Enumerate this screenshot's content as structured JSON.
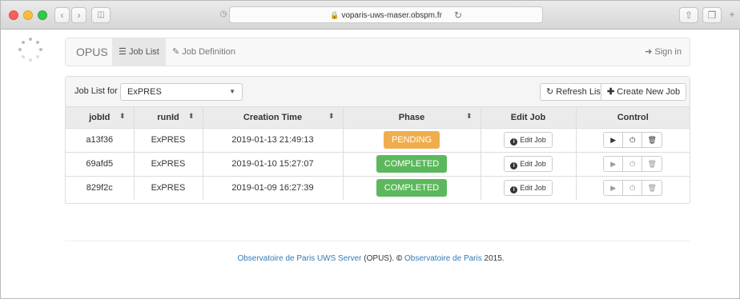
{
  "browser": {
    "address": "voparis-uws-maser.obspm.fr"
  },
  "navbar": {
    "brand": "OPUS",
    "job_list": "Job List",
    "job_definition": "Job Definition",
    "sign_in": "Sign in"
  },
  "panel": {
    "job_list_for_label": "Job List for",
    "selected_job": "ExPRES",
    "refresh_label": "Refresh List",
    "create_label": "Create New Job"
  },
  "table": {
    "headers": [
      "jobId",
      "runId",
      "Creation Time",
      "Phase",
      "Edit Job",
      "Control"
    ],
    "rows": [
      {
        "jobId": "a13f36",
        "runId": "ExPRES",
        "creation_time": "2019-01-13 21:49:13",
        "phase": "PENDING",
        "edit": "Edit Job"
      },
      {
        "jobId": "69afd5",
        "runId": "ExPRES",
        "creation_time": "2019-01-10 15:27:07",
        "phase": "COMPLETED",
        "edit": "Edit Job"
      },
      {
        "jobId": "829f2c",
        "runId": "ExPRES",
        "creation_time": "2019-01-09 16:27:39",
        "phase": "COMPLETED",
        "edit": "Edit Job"
      }
    ]
  },
  "footer": {
    "link1": "Observatoire de Paris UWS Server",
    "middle": " (OPUS). ",
    "link2": "Observatoire de Paris",
    "year": " 2015."
  },
  "colors": {
    "pending": "#f0ad4e",
    "completed": "#5cb85c",
    "link": "#337ab7"
  }
}
